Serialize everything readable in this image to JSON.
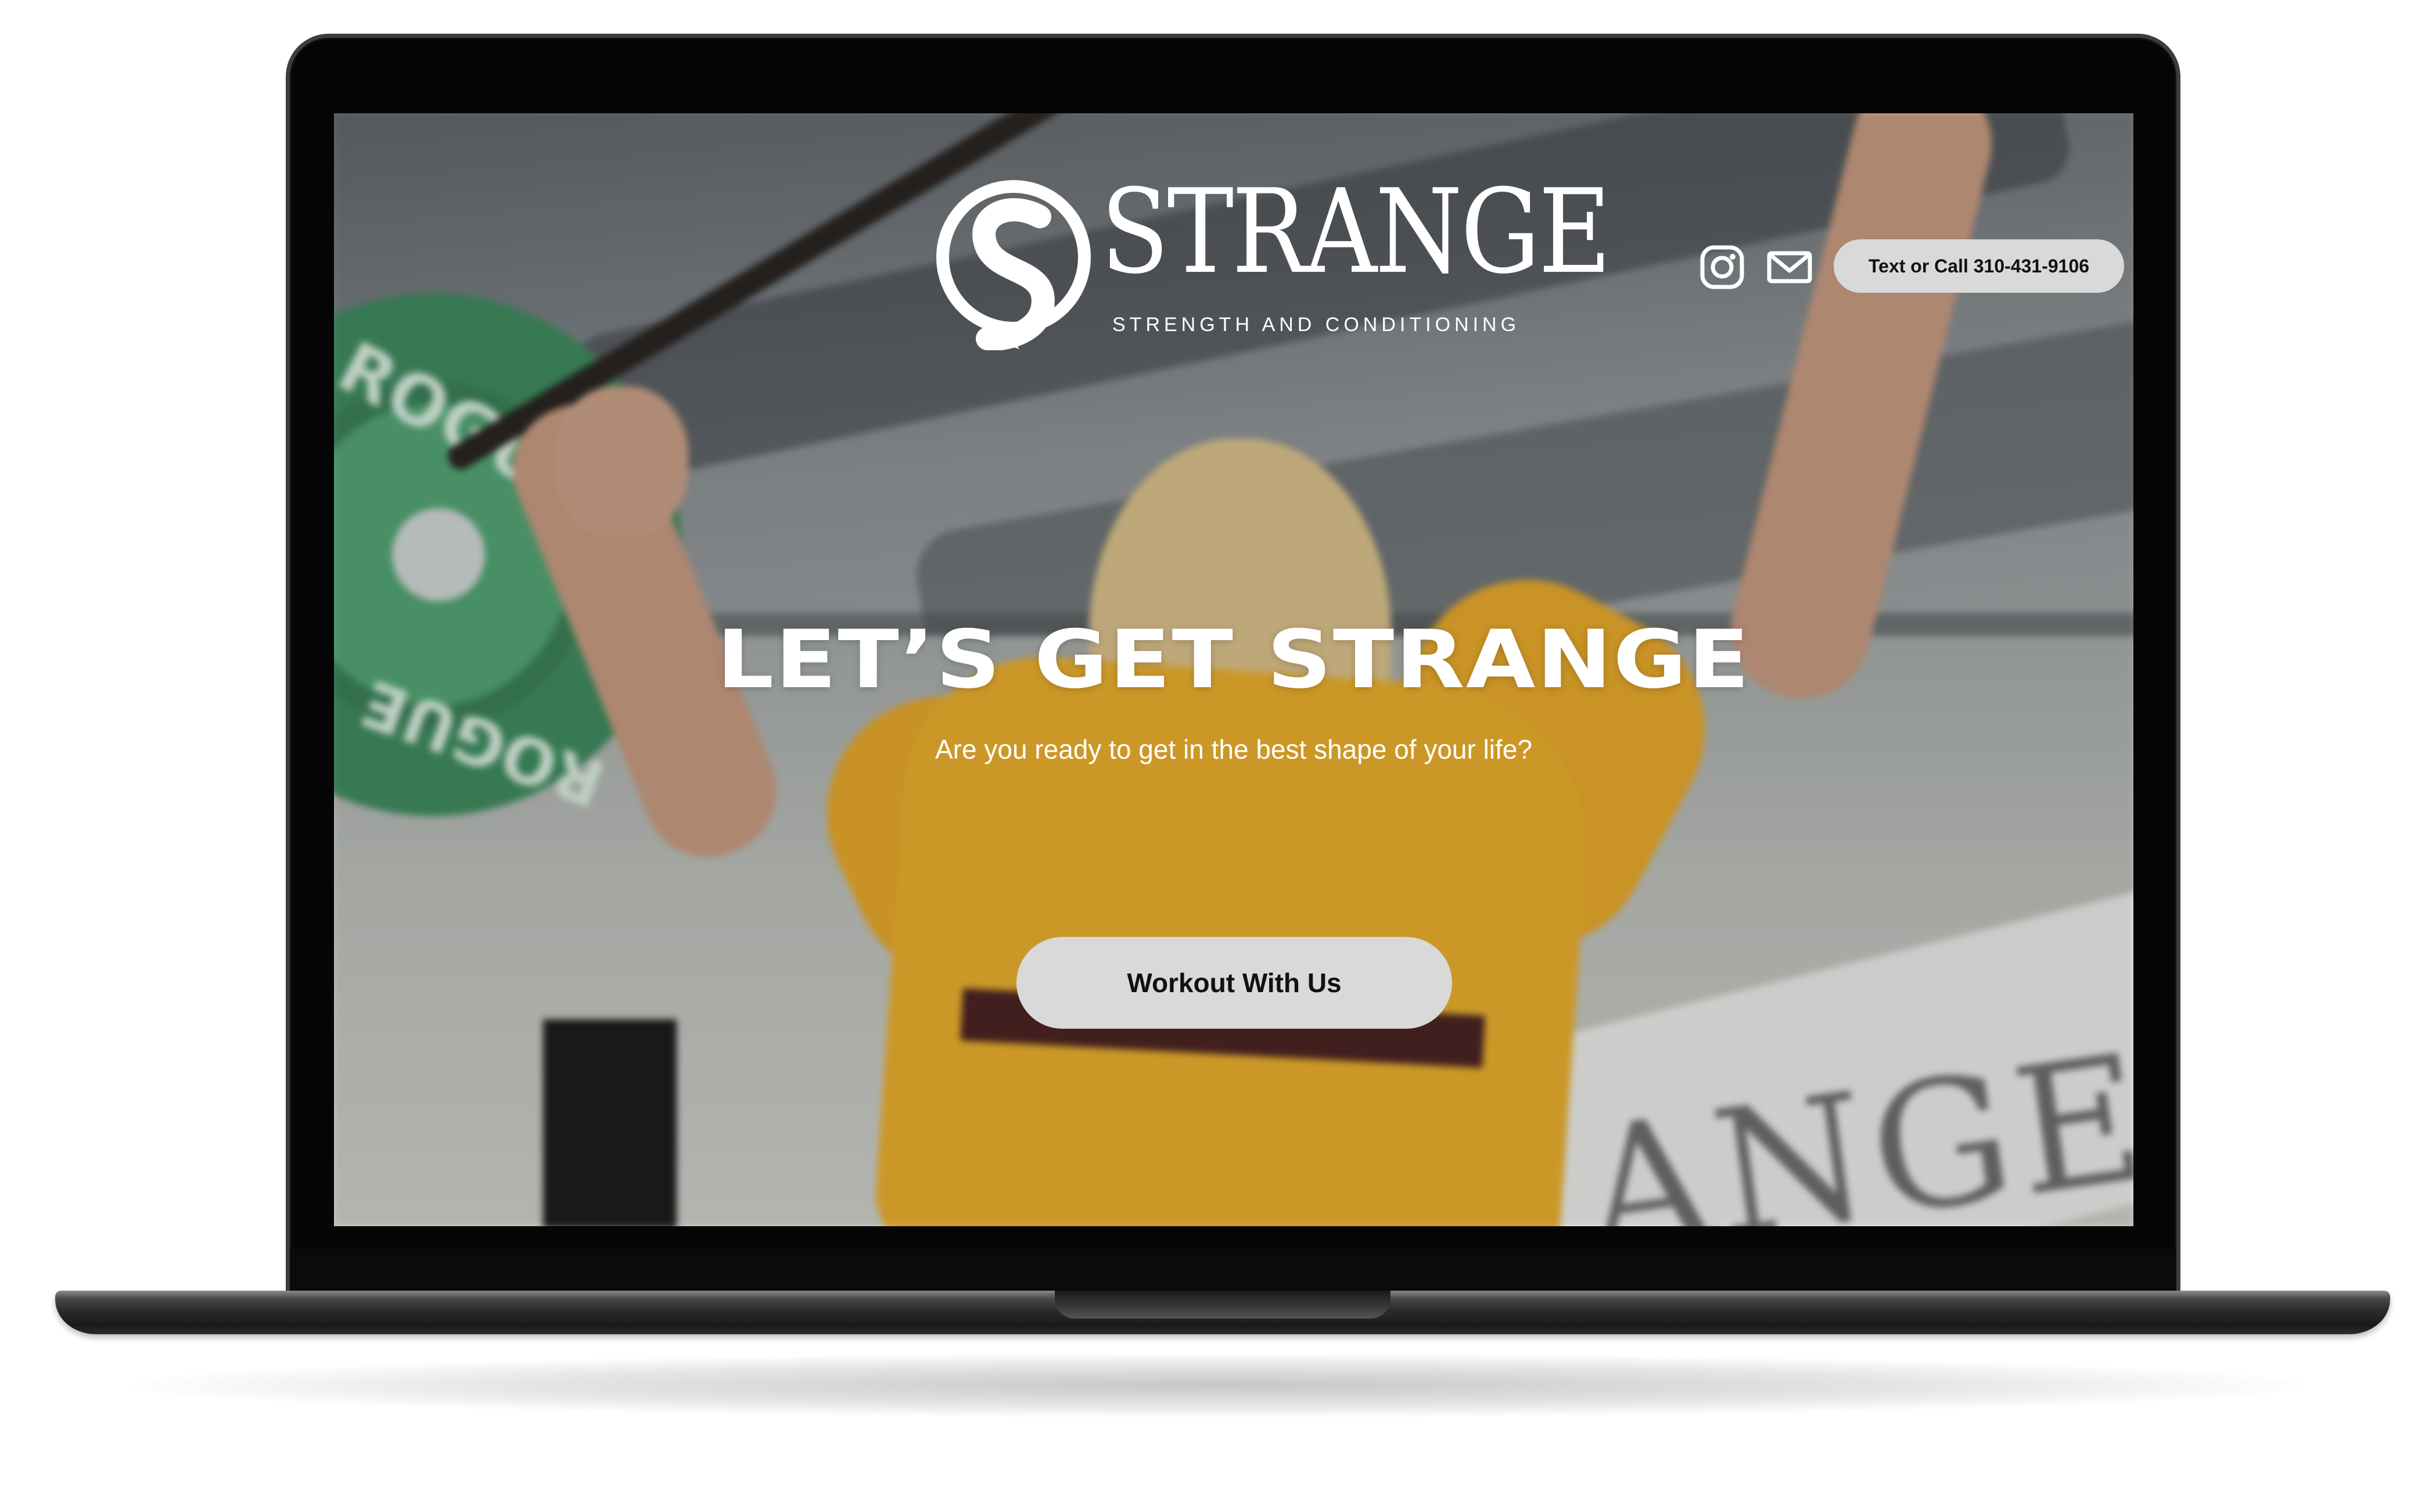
{
  "brand": {
    "name": "STRANGE",
    "tagline": "STRENGTH AND CONDITIONING"
  },
  "header": {
    "icons": [
      "instagram-icon",
      "mail-icon"
    ],
    "contact_button": "Text or Call 310-431-9106"
  },
  "hero": {
    "title": "LET’S GET STRANGE",
    "subtitle": "Are you ready to get in the best shape of your life?",
    "button": "Workout With Us"
  },
  "colors": {
    "button_bg": "#d9d9d9",
    "text": "#ffffff",
    "laptop_frame": "#050505"
  }
}
